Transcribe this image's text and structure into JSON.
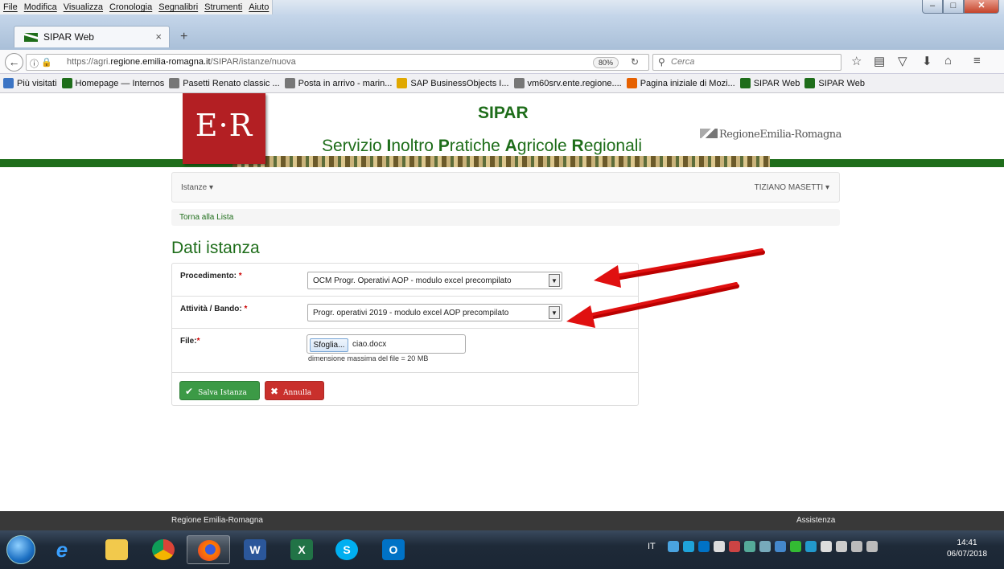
{
  "menu": [
    "File",
    "Modifica",
    "Visualizza",
    "Cronologia",
    "Segnalibri",
    "Strumenti",
    "Aiuto"
  ],
  "tab": {
    "title": "SIPAR Web",
    "close": "×",
    "new": "+"
  },
  "nav": {
    "url_prefix": "https://agri.",
    "url_domain": "regione.emilia-romagna.it",
    "url_path": "/SIPAR/istanze/nuova",
    "zoom": "80%",
    "search_placeholder": "Cerca"
  },
  "bookmarks": [
    {
      "label": "Più visitati",
      "color": "#3b74c4"
    },
    {
      "label": "Homepage — Internos",
      "color": "#1e6d1a"
    },
    {
      "label": "Pasetti Renato classic ...",
      "color": "#777777"
    },
    {
      "label": "Posta in arrivo - marin...",
      "color": "#777777"
    },
    {
      "label": "SAP BusinessObjects I...",
      "color": "#e0a800"
    },
    {
      "label": "vm60srv.ente.regione....",
      "color": "#777777"
    },
    {
      "label": "Pagina iniziale di Mozi...",
      "color": "#e66000"
    },
    {
      "label": "SIPAR Web",
      "color": "#1e6d1a"
    },
    {
      "label": "SIPAR Web",
      "color": "#1e6d1a"
    }
  ],
  "header": {
    "logo": "E·R",
    "app_name": "SIPAR",
    "sub_1": "Servizio ",
    "sub_I": "I",
    "sub_2": "noltro ",
    "sub_P": "P",
    "sub_3": "ratiche ",
    "sub_A": "A",
    "sub_4": "gricole ",
    "sub_R": "R",
    "sub_5": "egionali",
    "region": "RegioneEmilia-Romagna"
  },
  "app_nav": {
    "istanze": "Istanze ▾",
    "user": "TIZIANO MASETTI ▾"
  },
  "breadcrumb": "Torna alla Lista",
  "page_title": "Dati istanza",
  "form": {
    "procedimento_label": "Procedimento:",
    "procedimento_value": "OCM Progr. Operativi AOP - modulo excel precompilato",
    "attivita_label": "Attività / Bando:",
    "attivita_value": "Progr. operativi 2019 - modulo excel AOP precompilato",
    "file_label": "File:",
    "required": "*",
    "browse": "Sfoglia...",
    "file_name": "ciao.docx",
    "file_hint": "dimensione massima del file = 20 MB",
    "save": "Salva Istanza",
    "cancel": "Annulla"
  },
  "footer": {
    "left": "Regione Emilia-Romagna",
    "right": "Assistenza"
  },
  "taskbar": {
    "lang": "IT",
    "time": "14:41",
    "date": "06/07/2018"
  },
  "colors": {
    "brand_green": "#1e6d1a",
    "brand_red": "#b31f23",
    "save_green": "#3c9a46",
    "cancel_red": "#c9302c",
    "arrow_red": "#e01010"
  }
}
